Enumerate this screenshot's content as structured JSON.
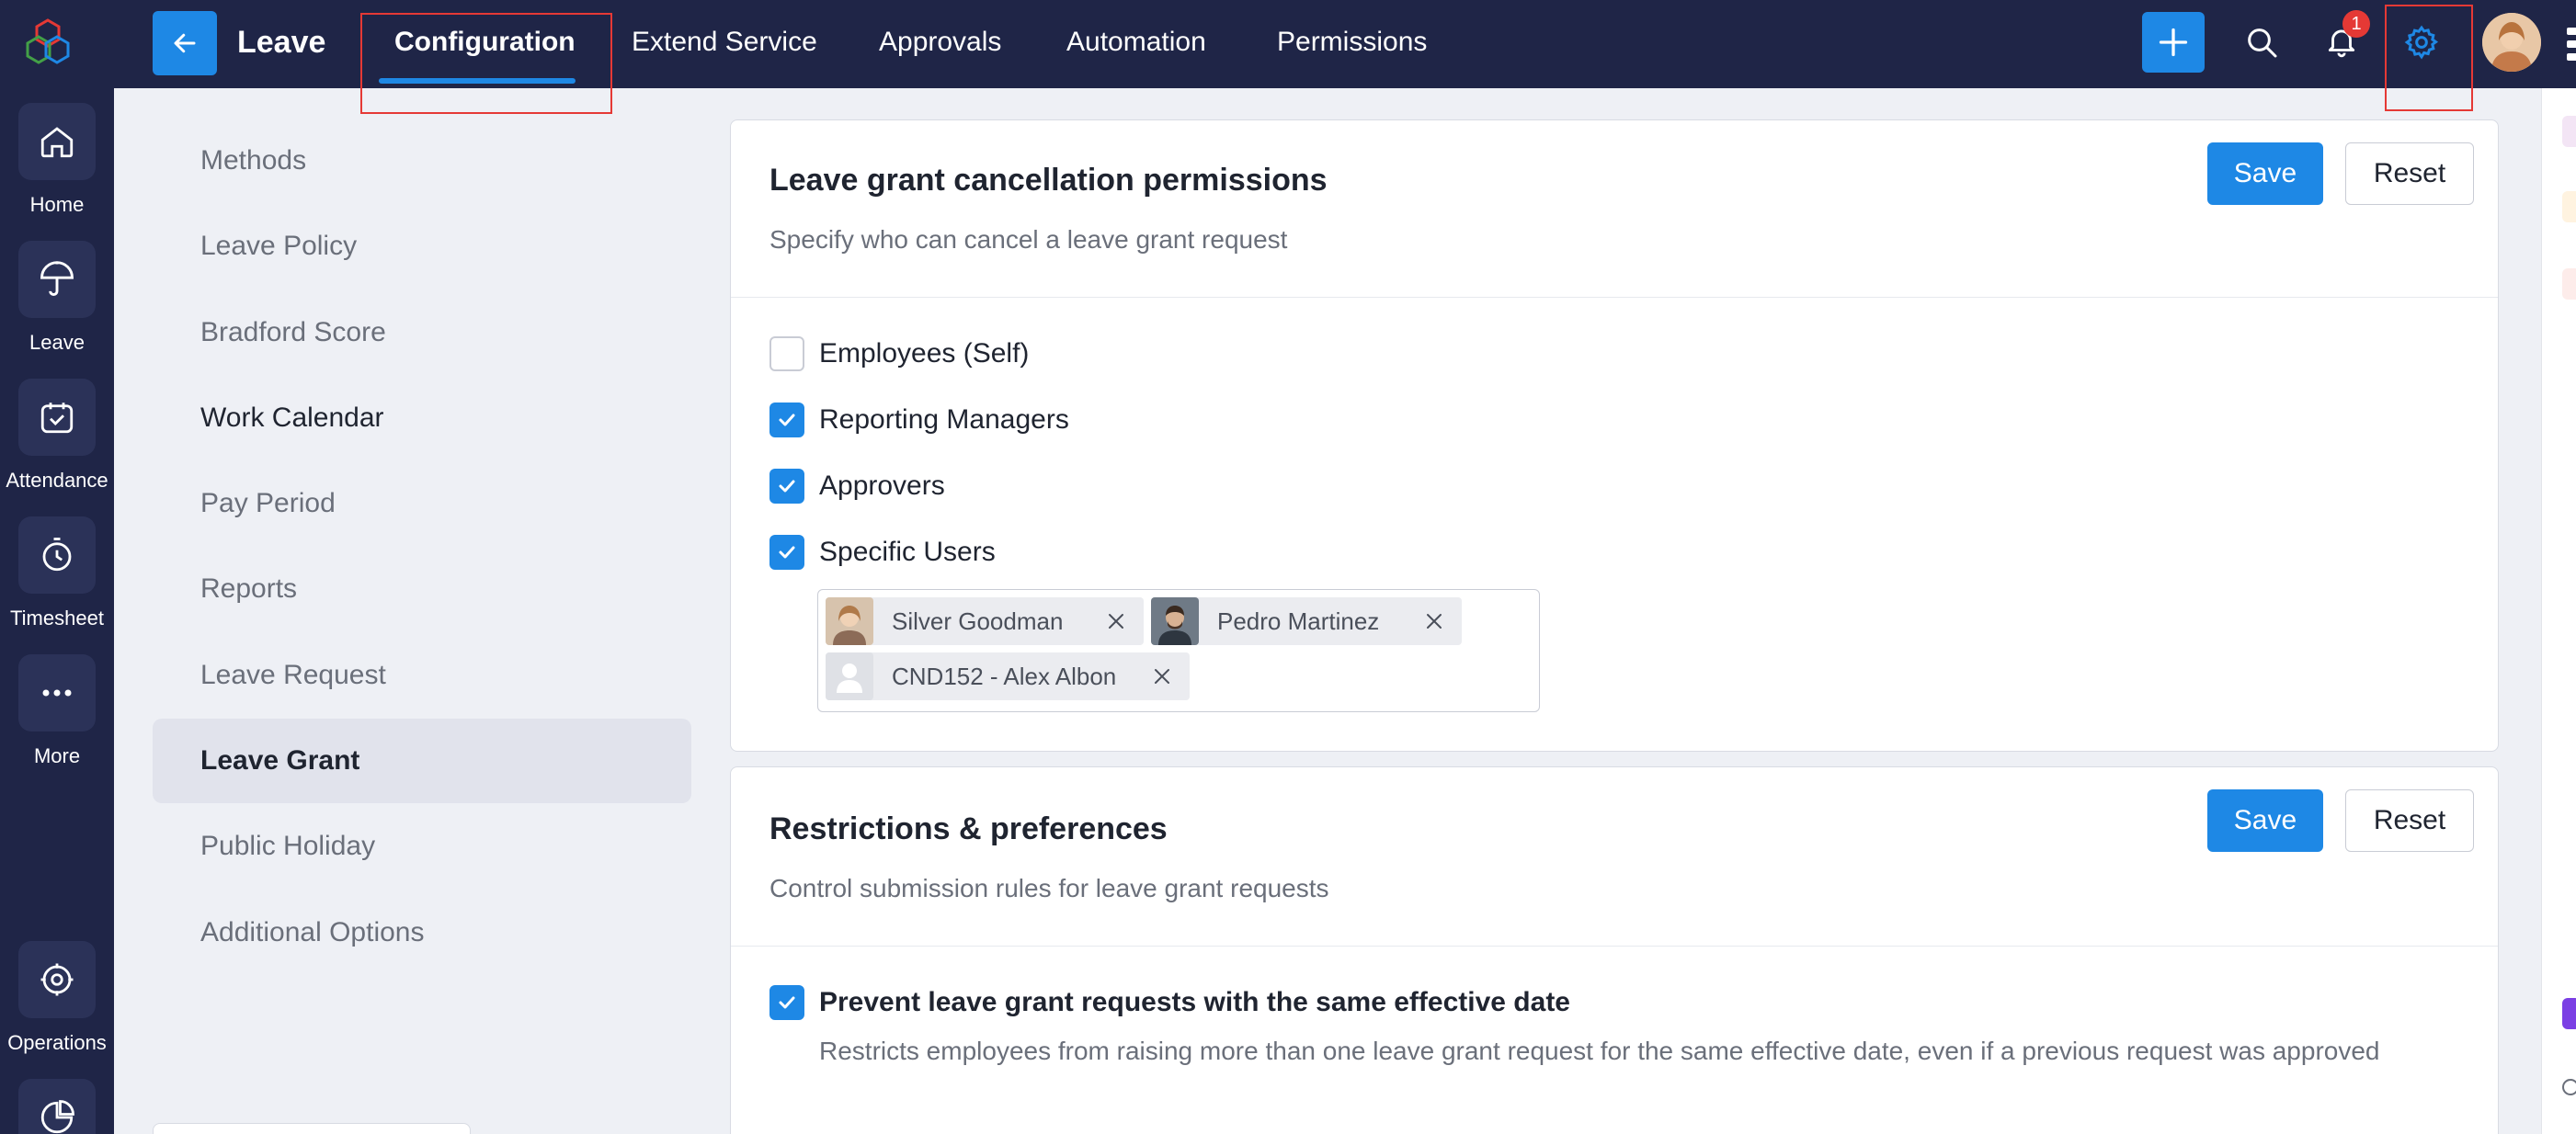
{
  "app": {
    "rail": [
      {
        "label": "Home",
        "icon": "home-icon"
      },
      {
        "label": "Leave",
        "icon": "umbrella-icon"
      },
      {
        "label": "Attendance",
        "icon": "calendar-check-icon"
      },
      {
        "label": "Timesheet",
        "icon": "timer-icon"
      },
      {
        "label": "More",
        "icon": "more-dots-icon"
      },
      {
        "label": "Operations",
        "icon": "operations-icon"
      }
    ]
  },
  "header": {
    "module_title": "Leave",
    "tabs": [
      {
        "label": "Configuration",
        "active": true
      },
      {
        "label": "Extend Service"
      },
      {
        "label": "Approvals"
      },
      {
        "label": "Automation"
      },
      {
        "label": "Permissions"
      }
    ],
    "notification_count": "1"
  },
  "sidebar": {
    "items": [
      {
        "label": "Methods"
      },
      {
        "label": "Leave Policy"
      },
      {
        "label": "Bradford Score"
      },
      {
        "label": "Work Calendar"
      },
      {
        "label": "Pay Period"
      },
      {
        "label": "Reports"
      },
      {
        "label": "Leave Request"
      },
      {
        "label": "Leave Grant",
        "active": true
      },
      {
        "label": "Public Holiday"
      },
      {
        "label": "Additional Options"
      }
    ]
  },
  "cancellation": {
    "title": "Leave grant cancellation permissions",
    "description": "Specify who can cancel a leave grant request",
    "save_label": "Save",
    "reset_label": "Reset",
    "options": [
      {
        "label": "Employees (Self)",
        "checked": false
      },
      {
        "label": "Reporting Managers",
        "checked": true
      },
      {
        "label": "Approvers",
        "checked": true
      },
      {
        "label": "Specific Users",
        "checked": true
      }
    ],
    "specific_users": [
      {
        "name": "Silver Goodman"
      },
      {
        "name": "Pedro Martinez"
      },
      {
        "name": "CND152 - Alex Albon"
      }
    ]
  },
  "restrictions": {
    "title": "Restrictions & preferences",
    "description": "Control submission rules for leave grant requests",
    "save_label": "Save",
    "reset_label": "Reset",
    "options": [
      {
        "label": "Prevent leave grant requests with the same effective date",
        "checked": true,
        "description": "Restricts employees from raising more than one leave grant request for the same effective date, even if a previous request was approved"
      }
    ]
  },
  "colors": {
    "accent": "#1e88e5",
    "navbar": "#1f2547",
    "highlight_box": "#e53935"
  }
}
